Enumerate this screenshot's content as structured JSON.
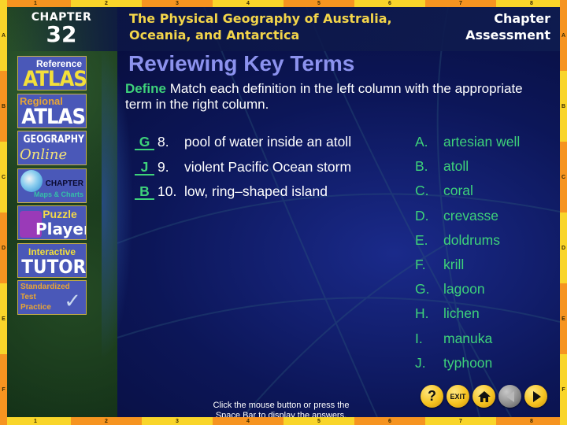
{
  "frame": {
    "columns": [
      "1",
      "2",
      "3",
      "4",
      "5",
      "6",
      "7",
      "8"
    ],
    "rows": [
      "A",
      "B",
      "C",
      "D",
      "E",
      "F"
    ]
  },
  "header": {
    "chapter_label": "CHAPTER",
    "chapter_number": "32",
    "book_title_line1": "The Physical Geography of Australia,",
    "book_title_line2": "Oceania, and Antarctica",
    "section_line1": "Chapter",
    "section_line2": "Assessment"
  },
  "sidebar": {
    "items": [
      {
        "id": "reference-atlas",
        "line1": "Reference",
        "line2": "ATLAS"
      },
      {
        "id": "regional-atlas",
        "line1": "Regional",
        "line2": "ATLAS"
      },
      {
        "id": "geography-online",
        "line1": "GEOGRAPHY",
        "line2": "Online"
      },
      {
        "id": "chapter-maps-charts",
        "line1": "CHAPTER",
        "line2": "Maps & Charts"
      },
      {
        "id": "puzzle-player",
        "line1": "Puzzle",
        "line2": "Player"
      },
      {
        "id": "interactive-tutor",
        "line1": "Interactive",
        "line2": "TUTOR"
      },
      {
        "id": "standardized-test",
        "line1": "Standardized",
        "line2": "Test",
        "line3": "Practice"
      }
    ]
  },
  "main": {
    "title": "Reviewing Key Terms",
    "instruction_keyword": "Define",
    "instruction_text": "  Match each definition in the left column with the appropriate term in the right column.",
    "definitions": [
      {
        "answer": "G",
        "number": "8.",
        "text": "pool of water inside an atoll"
      },
      {
        "answer": "J",
        "number": "9.",
        "text": "violent Pacific Ocean storm"
      },
      {
        "answer": "B",
        "number": "10.",
        "text": "low, ring–shaped island"
      }
    ],
    "terms": [
      {
        "letter": "A.",
        "term": "artesian well"
      },
      {
        "letter": "B.",
        "term": "atoll"
      },
      {
        "letter": "C.",
        "term": "coral"
      },
      {
        "letter": "D.",
        "term": "crevasse"
      },
      {
        "letter": "E.",
        "term": "doldrums"
      },
      {
        "letter": "F.",
        "term": "krill"
      },
      {
        "letter": "G.",
        "term": "lagoon"
      },
      {
        "letter": "H.",
        "term": "lichen"
      },
      {
        "letter": "I.",
        "term": "manuka"
      },
      {
        "letter": "J.",
        "term": "typhoon"
      }
    ],
    "hint_line1": "Click the mouse button or press the",
    "hint_line2": "Space Bar to display the answers."
  },
  "nav": {
    "help": "?",
    "exit": "EXIT",
    "home": "home-icon",
    "prev": "previous-icon",
    "next": "next-icon"
  },
  "colors": {
    "accent_green": "#3ed27a",
    "title_lavender": "#8c92ee",
    "header_gold": "#f3d54a",
    "frame_yellow": "#f9d52a",
    "frame_orange": "#f69420"
  }
}
